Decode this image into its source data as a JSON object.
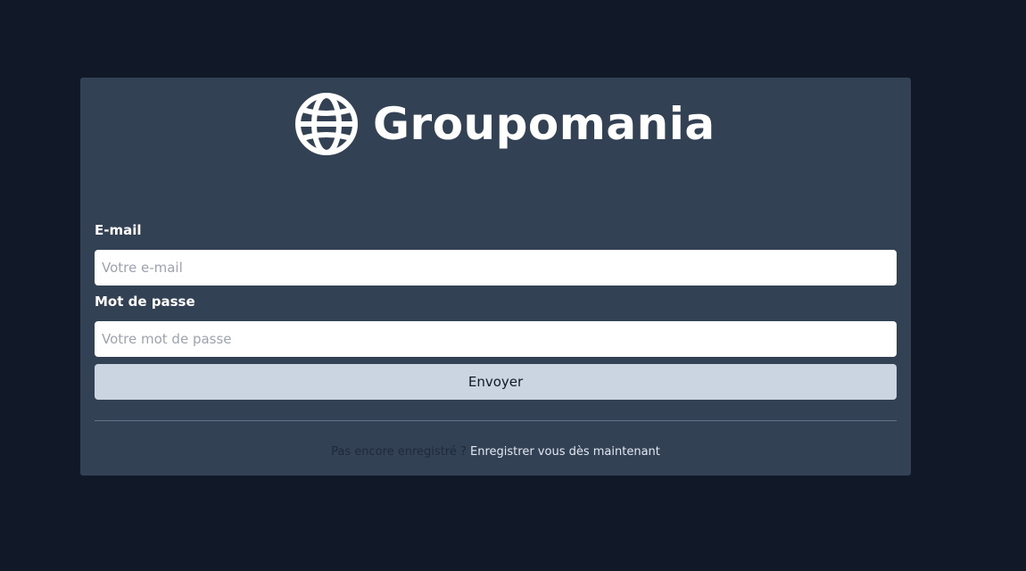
{
  "brand": {
    "name": "Groupomania",
    "icon": "globe-icon"
  },
  "form": {
    "email_label": "E-mail",
    "email_placeholder": "Votre e-mail",
    "email_value": "",
    "password_label": "Mot de passe",
    "password_placeholder": "Votre mot de passe",
    "password_value": "",
    "submit_label": "Envoyer"
  },
  "footer": {
    "prompt": "Pas encore enregistré ?",
    "register_link": "Enregistrer vous dès maintenant"
  },
  "colors": {
    "background": "#111827",
    "card": "#334155",
    "button": "#cbd5e1",
    "link": "#e2e8f0"
  }
}
